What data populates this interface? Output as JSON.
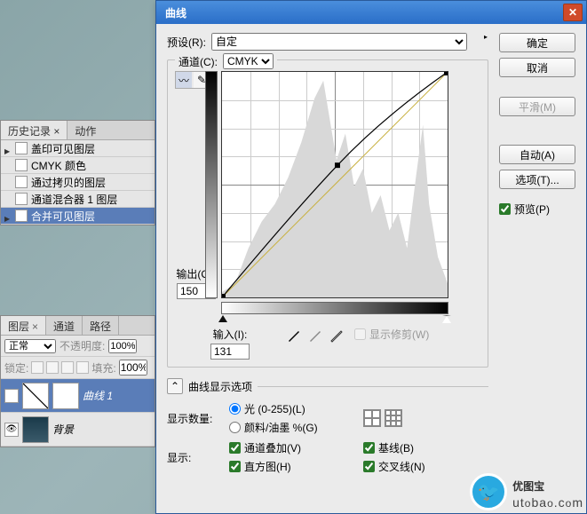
{
  "history": {
    "tab1": "历史记录",
    "tab2": "动作",
    "items": [
      "盖印可见图层",
      "CMYK 颜色",
      "通过拷贝的图层",
      "通道混合器 1 图层",
      "合并可见图层"
    ]
  },
  "layers": {
    "tabs": {
      "t1": "图层",
      "t2": "通道",
      "t3": "路径"
    },
    "mode": "正常",
    "opacity_label": "不透明度:",
    "opacity_value": "100%",
    "lock_label": "锁定:",
    "fill_label": "填充:",
    "fill_value": "100%",
    "items": [
      {
        "name": "曲线 1"
      },
      {
        "name": "背景"
      }
    ]
  },
  "dialog": {
    "title": "曲线",
    "preset_label": "预设(R):",
    "preset_value": "自定",
    "channel_label": "通道(C):",
    "channel_value": "CMYK",
    "output_label": "输出(O):",
    "output_value": "150",
    "input_label": "输入(I):",
    "input_value": "131",
    "show_clip": "显示修剪(W)",
    "expand_label": "曲线显示选项",
    "amount_label": "显示数量:",
    "radio_light": "光 (0-255)(L)",
    "radio_ink": "颜料/油墨 %(G)",
    "show_label": "显示:",
    "chk_overlay": "通道叠加(V)",
    "chk_baseline": "基线(B)",
    "chk_hist": "直方图(H)",
    "chk_cross": "交叉线(N)",
    "btn_ok": "确定",
    "btn_cancel": "取消",
    "btn_smooth": "平滑(M)",
    "btn_auto": "自动(A)",
    "btn_options": "选项(T)...",
    "chk_preview": "预览(P)",
    "chart_data": {
      "type": "curve",
      "x_range": [
        0,
        255
      ],
      "y_range": [
        0,
        255
      ],
      "points": [
        [
          0,
          0
        ],
        [
          131,
          150
        ],
        [
          255,
          255
        ]
      ],
      "baseline": [
        [
          0,
          0
        ],
        [
          255,
          255
        ]
      ],
      "input": 131,
      "output": 150
    }
  },
  "watermark": {
    "cn": "优图宝",
    "en": "utobao.com"
  }
}
